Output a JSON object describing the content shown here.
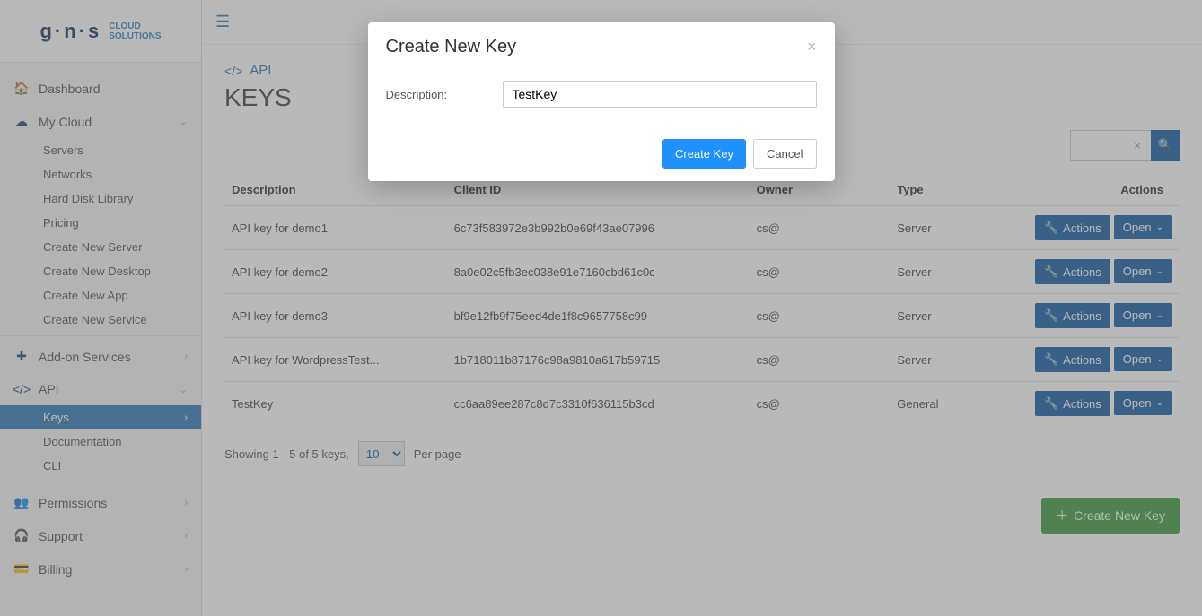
{
  "brand": {
    "name": "g·n·s",
    "sub1": "CLOUD",
    "sub2": "SOLUTIONS"
  },
  "sidebar": {
    "dashboard": "Dashboard",
    "mycloud": "My Cloud",
    "mycloud_items": [
      "Servers",
      "Networks",
      "Hard Disk Library",
      "Pricing",
      "Create New Server",
      "Create New Desktop",
      "Create New App",
      "Create New Service"
    ],
    "addon": "Add-on Services",
    "api": "API",
    "api_items": [
      "Keys",
      "Documentation",
      "CLI"
    ],
    "permissions": "Permissions",
    "support": "Support",
    "billing": "Billing"
  },
  "page": {
    "breadcrumb": "API",
    "title": "KEYS"
  },
  "table": {
    "headers": {
      "description": "Description",
      "client_id": "Client ID",
      "owner": "Owner",
      "type": "Type",
      "actions": "Actions"
    },
    "action_label": "Actions",
    "open_label": "Open"
  },
  "rows": [
    {
      "description": "API key for demo1",
      "client_id": "6c73f583972e3b992b0e69f43ae07996",
      "owner": "cs@",
      "type": "Server"
    },
    {
      "description": "API key for demo2",
      "client_id": "8a0e02c5fb3ec038e91e7160cbd61c0c",
      "owner": "cs@",
      "type": "Server"
    },
    {
      "description": "API key for demo3",
      "client_id": "bf9e12fb9f75eed4de1f8c9657758c99",
      "owner": "cs@",
      "type": "Server"
    },
    {
      "description": "API key for WordpressTest...",
      "client_id": "1b718011b87176c98a9810a617b59715",
      "owner": "cs@",
      "type": "Server"
    },
    {
      "description": "TestKey",
      "client_id": "cc6aa89ee287c8d7c3310f636115b3cd",
      "owner": "cs@",
      "type": "General"
    }
  ],
  "pager": {
    "showing": "Showing 1 - 5 of 5 keys,",
    "perpage": "Per page",
    "value": "10"
  },
  "create_button": "Create New Key",
  "modal": {
    "title": "Create New Key",
    "description_label": "Description:",
    "description_value": "TestKey",
    "create": "Create Key",
    "cancel": "Cancel"
  }
}
